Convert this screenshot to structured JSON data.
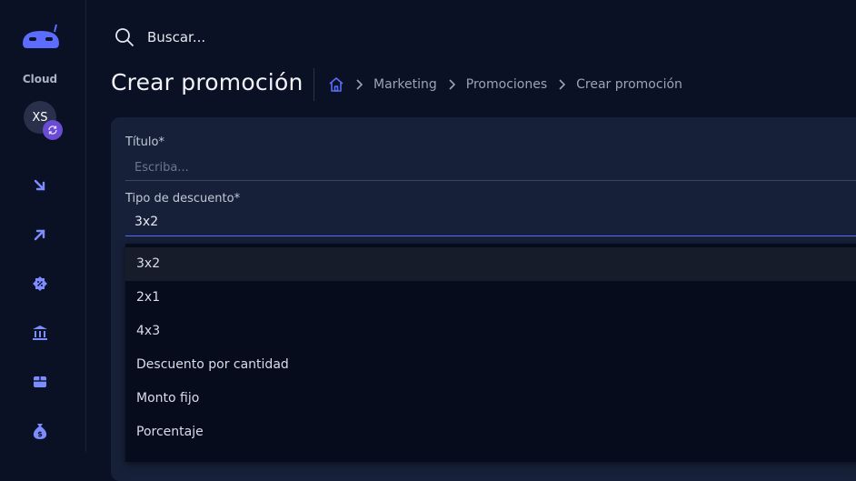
{
  "sidebar": {
    "cloud_label": "Cloud",
    "avatar_initials": "XS",
    "items": [
      {
        "icon": "arrow-down-right-icon"
      },
      {
        "icon": "arrow-up-right-icon"
      },
      {
        "icon": "discount-badge-icon"
      },
      {
        "icon": "bank-icon"
      },
      {
        "icon": "box-icon"
      },
      {
        "icon": "money-bag-icon"
      }
    ]
  },
  "search": {
    "placeholder": "Buscar..."
  },
  "header": {
    "title": "Crear promoción",
    "breadcrumb": [
      "Marketing",
      "Promociones",
      "Crear promoción"
    ]
  },
  "form": {
    "title_label": "Título*",
    "title_placeholder": "Escriba...",
    "discount_label": "Tipo de descuento*",
    "discount_value": "3x2",
    "options": [
      "3x2",
      "2x1",
      "4x3",
      "Descuento por cantidad",
      "Monto fijo",
      "Porcentaje"
    ]
  },
  "colors": {
    "background": "#0b1124",
    "card": "#162038",
    "accent": "#5b6cff",
    "icon": "#7d8cff"
  }
}
